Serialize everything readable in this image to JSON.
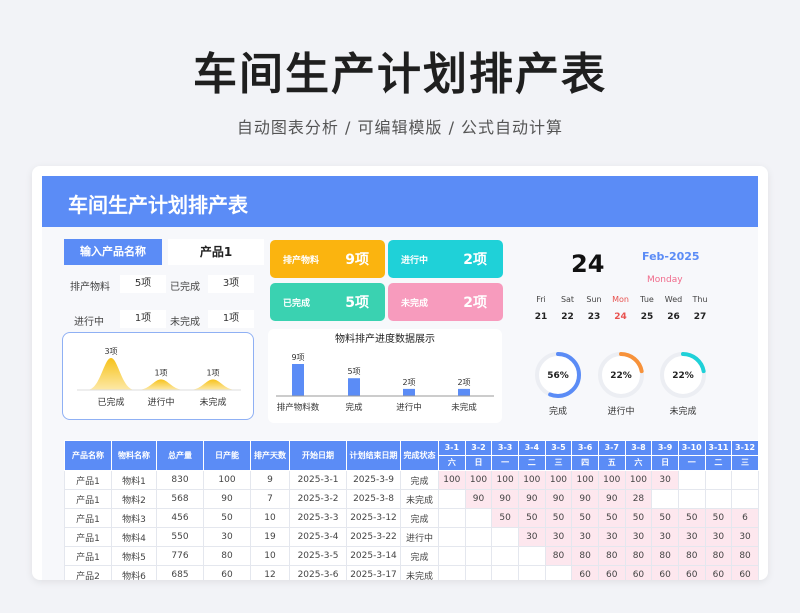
{
  "hero": {
    "title": "车间生产计划排产表",
    "subtitle": "自动图表分析 / 可编辑模版 / 公式自动计算"
  },
  "sheet": {
    "title": "车间生产计划排产表"
  },
  "input": {
    "label": "输入产品名称",
    "value": "产品1",
    "stats": [
      {
        "label": "排产物料",
        "value": "5项"
      },
      {
        "label": "已完成",
        "value": "3项"
      },
      {
        "label": "进行中",
        "value": "1项"
      },
      {
        "label": "未完成",
        "value": "1项"
      }
    ]
  },
  "mini_chart": {
    "peaks": [
      {
        "label": "已完成",
        "value_label": "3项",
        "value": 3
      },
      {
        "label": "进行中",
        "value_label": "1项",
        "value": 1
      },
      {
        "label": "未完成",
        "value_label": "1项",
        "value": 1
      }
    ]
  },
  "tiles": [
    {
      "label": "排产物料",
      "value": "9项",
      "color": "#fbb40f"
    },
    {
      "label": "进行中",
      "value": "2项",
      "color": "#1fd1d8"
    },
    {
      "label": "已完成",
      "value": "5项",
      "color": "#3ad2b1"
    },
    {
      "label": "未完成",
      "value": "2项",
      "color": "#f79bbd"
    }
  ],
  "chart_data": {
    "type": "bar",
    "title": "物料排产进度数据展示",
    "categories": [
      "排产物料数",
      "完成",
      "进行中",
      "未完成"
    ],
    "values": [
      9,
      5,
      2,
      2
    ],
    "data_labels": [
      "9项",
      "5项",
      "2项",
      "2项"
    ],
    "ylim": [
      0,
      10
    ],
    "color": "#5b8cf6"
  },
  "calendar": {
    "day": "24",
    "month": "Feb-2025",
    "weekday": "Monday",
    "week": [
      {
        "name": "Fri",
        "date": "21",
        "highlight": false
      },
      {
        "name": "Sat",
        "date": "22",
        "highlight": false
      },
      {
        "name": "Sun",
        "date": "23",
        "highlight": false
      },
      {
        "name": "Mon",
        "date": "24",
        "highlight": true
      },
      {
        "name": "Tue",
        "date": "25",
        "highlight": false
      },
      {
        "name": "Wed",
        "date": "26",
        "highlight": false
      },
      {
        "name": "Thu",
        "date": "27",
        "highlight": false
      }
    ],
    "highlight_color": "#e8524f"
  },
  "donuts": [
    {
      "value": 0.56,
      "label": "56%",
      "caption": "完成",
      "color": "#5b8cf6"
    },
    {
      "value": 0.22,
      "label": "22%",
      "caption": "进行中",
      "color": "#f7923a"
    },
    {
      "value": 0.22,
      "label": "22%",
      "caption": "未完成",
      "color": "#1fd1d8"
    }
  ],
  "table": {
    "headers": [
      "产品名称",
      "物料名称",
      "总产量",
      "日产能",
      "排产天数",
      "开始日期",
      "计划结束日期",
      "完成状态"
    ],
    "dates": [
      "3-1",
      "3-2",
      "3-3",
      "3-4",
      "3-5",
      "3-6",
      "3-7",
      "3-8",
      "3-9",
      "3-10",
      "3-11",
      "3-12"
    ],
    "weekdays": [
      "六",
      "日",
      "一",
      "二",
      "三",
      "四",
      "五",
      "六",
      "日",
      "一",
      "二",
      "三"
    ],
    "rows": [
      {
        "cells": [
          "产品1",
          "物料1",
          "830",
          "100",
          "9",
          "2025-3-1",
          "2025-3-9",
          "完成"
        ],
        "days": [
          "100",
          "100",
          "100",
          "100",
          "100",
          "100",
          "100",
          "100",
          "30",
          "",
          "",
          ""
        ]
      },
      {
        "cells": [
          "产品1",
          "物料2",
          "568",
          "90",
          "7",
          "2025-3-2",
          "2025-3-8",
          "未完成"
        ],
        "days": [
          "",
          "90",
          "90",
          "90",
          "90",
          "90",
          "90",
          "28",
          "",
          "",
          "",
          ""
        ]
      },
      {
        "cells": [
          "产品1",
          "物料3",
          "456",
          "50",
          "10",
          "2025-3-3",
          "2025-3-12",
          "完成"
        ],
        "days": [
          "",
          "",
          "50",
          "50",
          "50",
          "50",
          "50",
          "50",
          "50",
          "50",
          "50",
          "6"
        ]
      },
      {
        "cells": [
          "产品1",
          "物料4",
          "550",
          "30",
          "19",
          "2025-3-4",
          "2025-3-22",
          "进行中"
        ],
        "days": [
          "",
          "",
          "",
          "30",
          "30",
          "30",
          "30",
          "30",
          "30",
          "30",
          "30",
          "30"
        ]
      },
      {
        "cells": [
          "产品1",
          "物料5",
          "776",
          "80",
          "10",
          "2025-3-5",
          "2025-3-14",
          "完成"
        ],
        "days": [
          "",
          "",
          "",
          "",
          "80",
          "80",
          "80",
          "80",
          "80",
          "80",
          "80",
          "80"
        ]
      },
      {
        "cells": [
          "产品2",
          "物料6",
          "685",
          "60",
          "12",
          "2025-3-6",
          "2025-3-17",
          "未完成"
        ],
        "days": [
          "",
          "",
          "",
          "",
          "",
          "60",
          "60",
          "60",
          "60",
          "60",
          "60",
          "60"
        ]
      }
    ]
  }
}
